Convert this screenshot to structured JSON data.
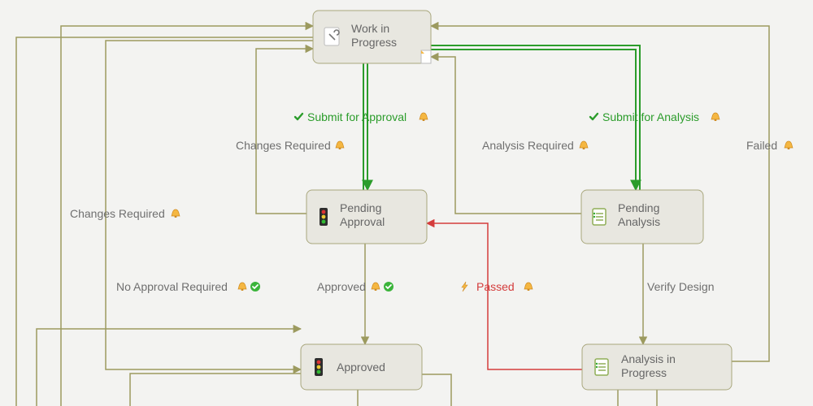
{
  "diagram": {
    "type": "state-workflow",
    "nodes": {
      "wip": {
        "label_line1": "Work in",
        "label_line2": "Progress"
      },
      "pendingAppr": {
        "label_line1": "Pending",
        "label_line2": "Approval"
      },
      "pendingAnal": {
        "label_line1": "Pending",
        "label_line2": "Analysis"
      },
      "approved": {
        "label": "Approved"
      },
      "analysisIP": {
        "label_line1": "Analysis in",
        "label_line2": "Progress"
      }
    },
    "transitions": {
      "submit_for_approval": {
        "label": "Submit for Approval",
        "style": "green",
        "icons": [
          "check",
          "bell"
        ]
      },
      "submit_for_analysis": {
        "label": "Submit for Analysis",
        "style": "green",
        "icons": [
          "check",
          "bell"
        ]
      },
      "changes_required_1": {
        "label": "Changes Required",
        "style": "grey",
        "icons": [
          "bell"
        ]
      },
      "analysis_required": {
        "label": "Analysis Required",
        "style": "grey",
        "icons": [
          "bell"
        ]
      },
      "failed": {
        "label": "Failed",
        "style": "grey",
        "icons": [
          "bell"
        ]
      },
      "changes_required_2": {
        "label": "Changes Required",
        "style": "grey",
        "icons": [
          "bell"
        ]
      },
      "no_approval_required": {
        "label": "No Approval Required",
        "style": "grey",
        "icons": [
          "bell",
          "ok"
        ]
      },
      "approved_t": {
        "label": "Approved",
        "style": "grey",
        "icons": [
          "bell",
          "ok"
        ]
      },
      "passed": {
        "label": "Passed",
        "style": "red",
        "icons": [
          "bolt",
          "bell"
        ]
      },
      "verify_design": {
        "label": "Verify Design",
        "style": "grey",
        "icons": []
      }
    },
    "node_icons": {
      "wip": "wrench-doc",
      "pendingAppr": "traffic-light",
      "pendingAnal": "checklist",
      "approved": "traffic-light",
      "analysisIP": "checklist"
    }
  }
}
